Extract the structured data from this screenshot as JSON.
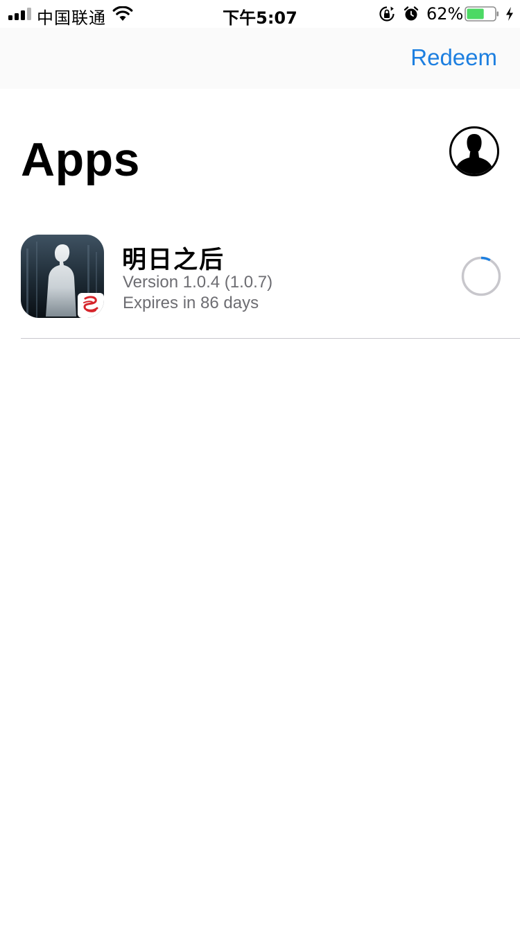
{
  "status_bar": {
    "carrier": "中国联通",
    "time": "下午5:07",
    "battery_percent": "62%",
    "battery_level": 0.62,
    "signal_bars": 3,
    "signal_bars_total": 4,
    "icons": [
      "signal-icon",
      "wifi-icon",
      "rotation-lock-icon",
      "alarm-icon",
      "battery-icon",
      "charging-icon"
    ]
  },
  "nav": {
    "redeem_label": "Redeem"
  },
  "page": {
    "title": "Apps"
  },
  "apps": [
    {
      "name": "明日之后",
      "version": "Version 1.0.4 (1.0.7)",
      "expires": "Expires in 86 days",
      "progress": 0.08,
      "icon": "app-icon-silhouette"
    }
  ],
  "colors": {
    "accent": "#1d7fe0",
    "secondary_text": "#6d6d72",
    "separator": "#c8c7cc",
    "nav_background": "#fafafa",
    "battery_fill": "#4cd964",
    "progress_track": "#c8c7cc"
  }
}
